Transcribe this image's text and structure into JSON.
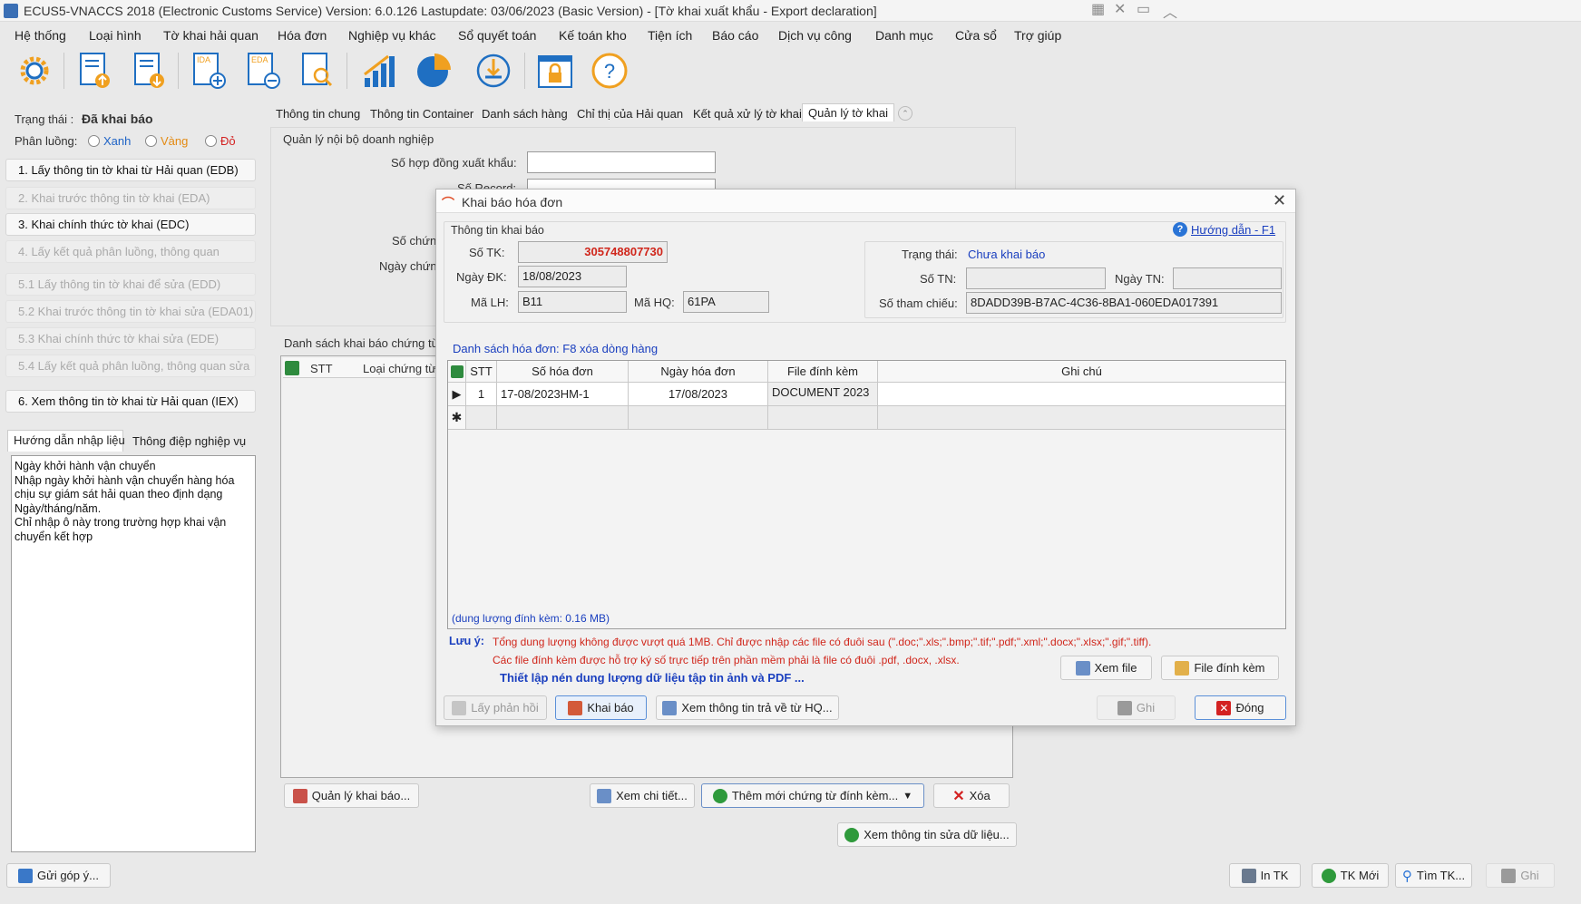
{
  "window": {
    "title": "ECUS5-VNACCS 2018 (Electronic Customs Service) Version: 6.0.126 Lastupdate: 03/06/2023 (Basic Version) - [Tờ khai xuất khẩu - Export declaration]"
  },
  "menu": [
    "Hệ thống",
    "Loại hình",
    "Tờ khai hải quan",
    "Hóa đơn",
    "Nghiệp vụ khác",
    "Sổ quyết toán",
    "Kế toán kho",
    "Tiện ích",
    "Báo cáo",
    "Dịch vụ công",
    "Danh mục",
    "Cửa sổ",
    "Trợ giúp"
  ],
  "toolbar": {
    "icons": [
      "settings-gear-icon",
      "declaration-upload-icon",
      "declaration-download-icon",
      "ida-add-icon",
      "eda-remove-icon",
      "search-document-icon",
      "bar-chart-icon",
      "pie-chart-icon",
      "download-circle-icon",
      "lock-icon",
      "help-icon"
    ],
    "ida": "IDA",
    "eda": "EDA"
  },
  "status": {
    "label": "Trạng thái :",
    "value": "Đã khai báo",
    "flow_label": "Phân luồng:",
    "flows": [
      "Xanh",
      "Vàng",
      "Đỏ"
    ],
    "flow_colors": [
      "#1e63c6",
      "#e38a12",
      "#d32222"
    ]
  },
  "steps": [
    {
      "label": "1. Lấy thông tin tờ khai từ Hải quan (EDB)",
      "enabled": true
    },
    {
      "label": "2. Khai trước thông tin tờ khai (EDA)",
      "enabled": false
    },
    {
      "label": "3. Khai chính thức tờ khai (EDC)",
      "enabled": true
    },
    {
      "label": "4. Lấy kết quả phân luồng, thông quan",
      "enabled": false
    },
    {
      "label": "5.1 Lấy thông tin tờ khai để sửa (EDD)",
      "enabled": false
    },
    {
      "label": "5.2 Khai trước thông tin tờ khai sửa (EDA01)",
      "enabled": false
    },
    {
      "label": "5.3 Khai chính thức tờ khai sửa (EDE)",
      "enabled": false
    },
    {
      "label": "5.4 Lấy kết quả phân luồng, thông quan sửa",
      "enabled": false
    },
    {
      "label": "6. Xem thông tin tờ khai từ Hải quan (IEX)",
      "enabled": true
    }
  ],
  "help_tabs": [
    "Hướng dẫn nhập liệu",
    "Thông điệp nghiệp vụ"
  ],
  "help_text": "Ngày khởi hành vận chuyển\nNhập ngày khởi hành vận chuyển hàng hóa chịu sự giám sát hải quan theo định dạng Ngày/tháng/năm.\nChỉ nhập ô này trong trường hợp khai vận chuyển kết hợp",
  "main_tabs": [
    "Thông tin chung",
    "Thông tin Container",
    "Danh sách hàng",
    "Chỉ thị của Hải quan",
    "Kết quả xử lý tờ khai",
    "Quản lý tờ khai"
  ],
  "background_form": {
    "group_title": "Quản lý nội bộ doanh nghiệp",
    "contract_label": "Số hợp đồng xuất khẩu:",
    "record_label": "Số Record:",
    "cert_no_label": "Số chứn",
    "cert_date_label": "Ngày chứn",
    "list_title": "Danh sách khai báo chứng từ",
    "list_cols": [
      "STT",
      "Loại chứng từ"
    ],
    "buttons": {
      "manage": "Quản lý khai báo...",
      "detail": "Xem chi tiết...",
      "add_new": "Thêm mới chứng từ đính kèm...",
      "delete": "Xóa",
      "view_edit": "Xem thông tin sửa dữ liệu..."
    }
  },
  "dialog": {
    "title": "Khai báo hóa đơn",
    "help_link": "Hướng dẫn - F1",
    "info_group": "Thông tin khai báo",
    "so_tk_label": "Số TK:",
    "so_tk": "305748807730",
    "ngay_dk_label": "Ngày ĐK:",
    "ngay_dk": "18/08/2023",
    "ma_lh_label": "Mã LH:",
    "ma_lh": "B11",
    "ma_hq_label": "Mã HQ:",
    "ma_hq": "61PA",
    "trang_thai_label": "Trạng thái:",
    "trang_thai": "Chưa khai báo",
    "so_tn_label": "Số TN:",
    "so_tn": "",
    "ngay_tn_label": "Ngày TN:",
    "ngay_tn": "",
    "so_tham_chieu_label": "Số tham chiếu:",
    "so_tham_chieu": "8DADD39B-B7AC-4C36-8BA1-060EDA017391",
    "list_label": "Danh sách hóa đơn: F8 xóa dòng hàng",
    "columns": [
      "STT",
      "Số hóa đơn",
      "Ngày hóa đơn",
      "File đính kèm",
      "Ghi chú"
    ],
    "rows": [
      {
        "stt": "1",
        "so_hd": "17-08/2023HM-1",
        "ngay_hd": "17/08/2023",
        "file": "DOCUMENT 2023",
        "ghi_chu": ""
      }
    ],
    "attach_size": "(dung lượng đính kèm: 0.16 MB)",
    "note_label": "Lưu ý:",
    "note1": "Tổng dung lượng không được vượt quá 1MB. Chỉ được nhập các file có đuôi sau (\".doc;\".xls;\".bmp;\".tif;\".pdf;\".xml;\".docx;\".xlsx;\".gif;\".tiff).",
    "note2": "Các file đính kèm được hỗ trợ ký số trực tiếp trên phần mềm phải là file có đuôi .pdf, .docx, .xlsx.",
    "compress_link": "Thiết lập nén dung lượng dữ liệu tập tin ảnh và PDF ...",
    "buttons": {
      "view_file": "Xem file",
      "attach_file": "File đính kèm",
      "get_response": "Lấy phản hồi",
      "declare": "Khai báo",
      "view_returned": "Xem thông tin trả về từ HQ...",
      "save": "Ghi",
      "close": "Đóng"
    }
  },
  "bottom": {
    "feedback": "Gửi góp ý...",
    "print": "In TK",
    "new": "TK Mới",
    "find": "Tìm TK...",
    "save": "Ghi"
  }
}
